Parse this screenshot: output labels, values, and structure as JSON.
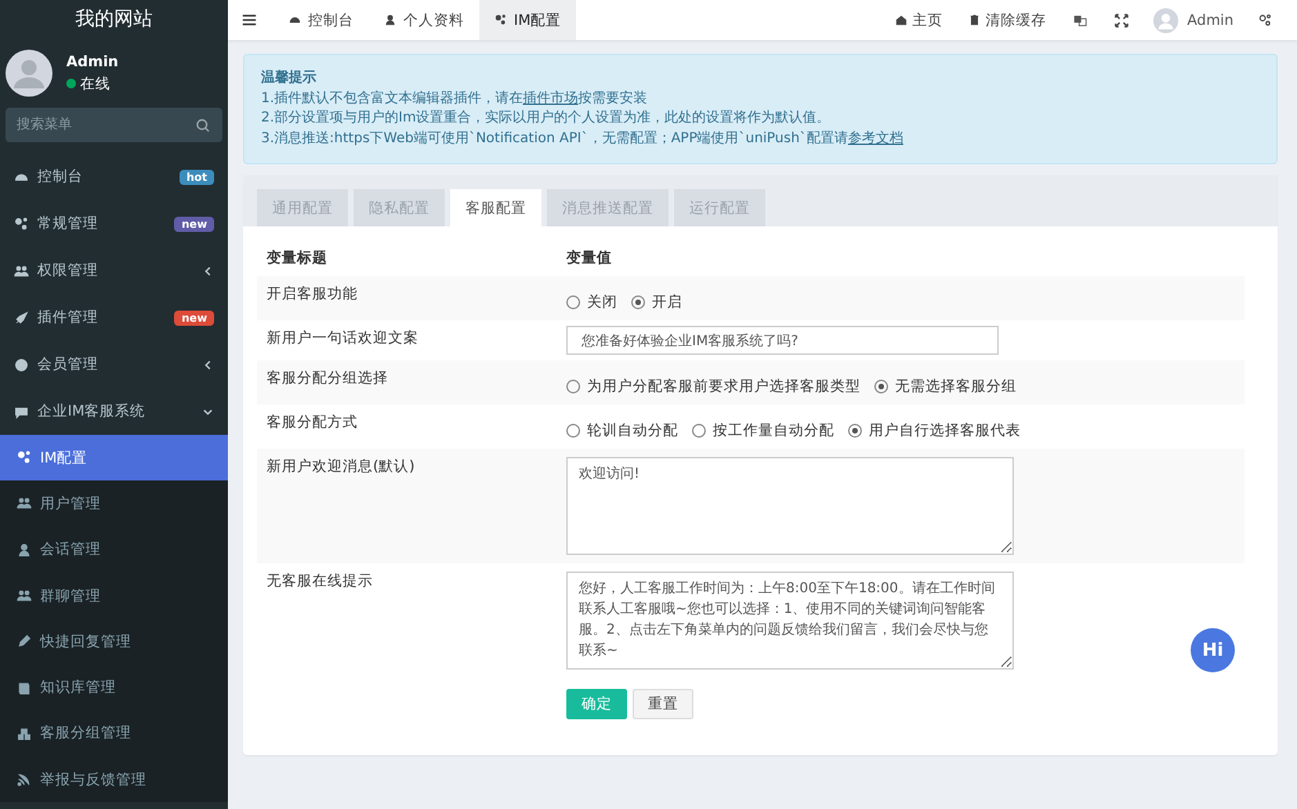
{
  "sidebar": {
    "site_title": "我的网站",
    "user": {
      "name": "Admin",
      "status": "在线"
    },
    "search": {
      "placeholder": "搜索菜单"
    },
    "items": [
      {
        "label": "控制台",
        "badge": {
          "text": "hot",
          "color": "#3c8dbc"
        },
        "selected": false
      },
      {
        "label": "常规管理",
        "badge": {
          "text": "new",
          "color": "#605ca8"
        },
        "selected": false
      },
      {
        "label": "权限管理",
        "expanded": false,
        "selected": false
      },
      {
        "label": "插件管理",
        "badge": {
          "text": "new",
          "color": "#dd4b39"
        },
        "selected": false
      },
      {
        "label": "会员管理",
        "expanded": false,
        "selected": false
      },
      {
        "label": "企业IM客服系统",
        "expanded": true,
        "selected": false,
        "children": [
          {
            "label": "IM配置",
            "selected": true
          },
          {
            "label": "用户管理",
            "selected": false
          },
          {
            "label": "会话管理",
            "selected": false
          },
          {
            "label": "群聊管理",
            "selected": false
          },
          {
            "label": "快捷回复管理",
            "selected": false
          },
          {
            "label": "知识库管理",
            "selected": false
          },
          {
            "label": "客服分组管理",
            "selected": false
          },
          {
            "label": "举报与反馈管理",
            "selected": false
          }
        ]
      }
    ]
  },
  "topbar": {
    "tabs": [
      {
        "label": "控制台",
        "selected": false
      },
      {
        "label": "个人资料",
        "selected": false
      },
      {
        "label": "IM配置",
        "selected": true
      }
    ],
    "right": [
      {
        "label": "主页"
      },
      {
        "label": "清除缓存"
      }
    ],
    "user": "Admin"
  },
  "notice": {
    "title": "温馨提示",
    "lines": [
      [
        {
          "text": "1.插件默认不包含富文本编辑器插件，请在",
          "link": false
        },
        {
          "text": "插件市场",
          "link": true
        },
        {
          "text": "按需要安装",
          "link": false
        }
      ],
      [
        {
          "text": "2.部分设置项与用户的Im设置重合，实际以用户的个人设置为准，此处的设置将作为默认值。",
          "link": false
        }
      ],
      [
        {
          "text": "3.消息推送:https下Web端可使用`Notification API`，无需配置；APP端使用`uniPush`配置请",
          "link": false
        },
        {
          "text": "参考文档",
          "link": true
        }
      ]
    ]
  },
  "config_tabs": [
    {
      "label": "通用配置",
      "selected": false
    },
    {
      "label": "隐私配置",
      "selected": false
    },
    {
      "label": "客服配置",
      "selected": true
    },
    {
      "label": "消息推送配置",
      "selected": false
    },
    {
      "label": "运行配置",
      "selected": false
    }
  ],
  "table": {
    "columns": [
      "变量标题",
      "变量值"
    ],
    "rows": [
      {
        "title": "开启客服功能",
        "kind": "radio",
        "options": [
          {
            "label": "关闭",
            "selected": false
          },
          {
            "label": "开启",
            "selected": true
          }
        ]
      },
      {
        "title": "新用户一句话欢迎文案",
        "kind": "input",
        "value": "您准备好体验企业IM客服系统了吗?"
      },
      {
        "title": "客服分配分组选择",
        "kind": "radio",
        "options": [
          {
            "label": "为用户分配客服前要求用户选择客服类型",
            "selected": false
          },
          {
            "label": "无需选择客服分组",
            "selected": true
          }
        ]
      },
      {
        "title": "客服分配方式",
        "kind": "radio",
        "options": [
          {
            "label": "轮训自动分配",
            "selected": false
          },
          {
            "label": "按工作量自动分配",
            "selected": false
          },
          {
            "label": "用户自行选择客服代表",
            "selected": true
          }
        ]
      },
      {
        "title": "新用户欢迎消息(默认)",
        "kind": "textarea",
        "value": "欢迎访问!"
      },
      {
        "title": "无客服在线提示",
        "kind": "textarea",
        "value": "您好，人工客服工作时间为：上午8:00至下午18:00。请在工作时间联系人工客服哦~您也可以选择：1、使用不同的关键词询问智能客服。2、点击左下角菜单内的问题反馈给我们留言，我们会尽快与您联系~"
      }
    ]
  },
  "buttons": [
    {
      "label": "确定",
      "kind": "primary"
    },
    {
      "label": "重置",
      "kind": "default"
    }
  ],
  "chat_bubble": "Hi"
}
